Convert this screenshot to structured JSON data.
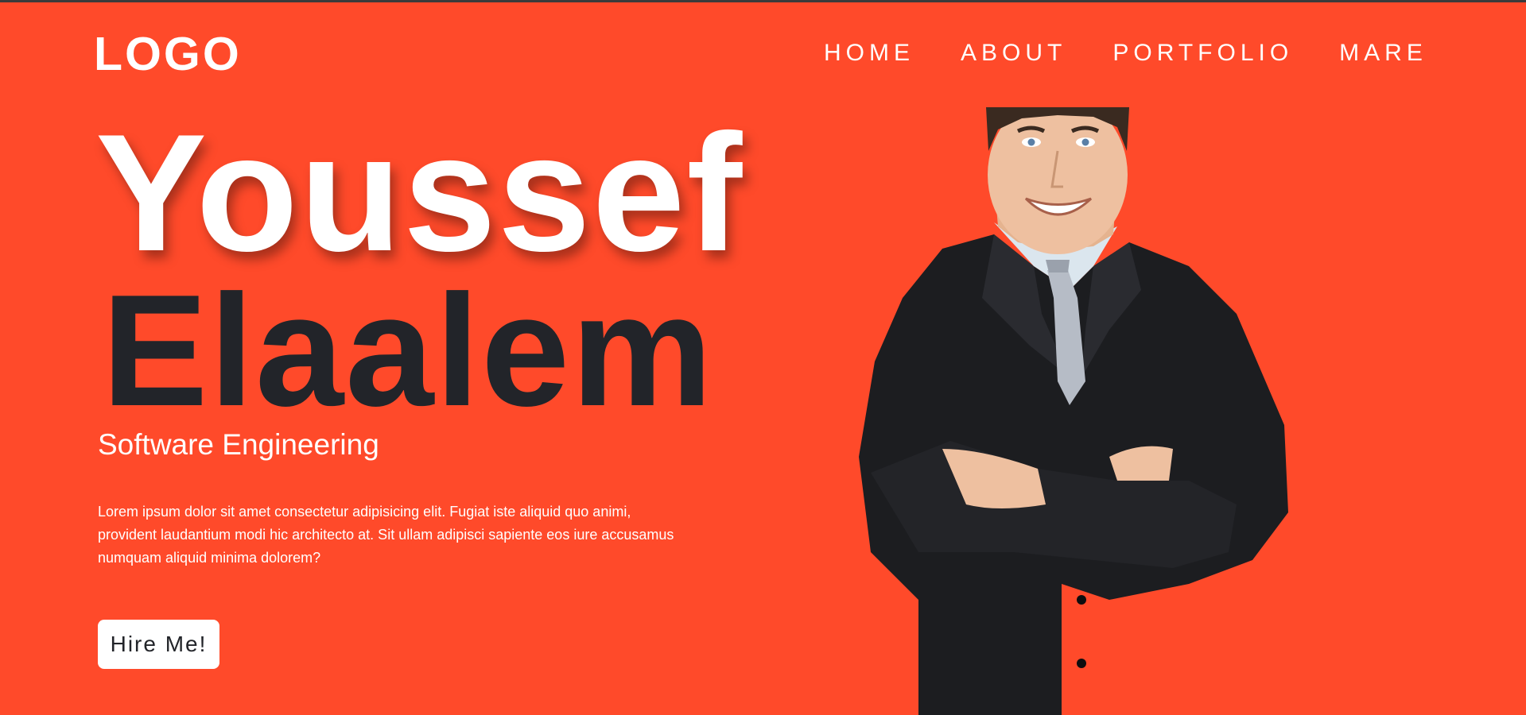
{
  "header": {
    "logo": "LOGO",
    "nav": [
      {
        "label": "HOME"
      },
      {
        "label": "ABOUT"
      },
      {
        "label": "PORTFOLIO"
      },
      {
        "label": "MARE"
      }
    ]
  },
  "hero": {
    "first_name": "Youssef",
    "last_name": "Elaalem",
    "subtitle": "Software Engineering",
    "description": "Lorem ipsum dolor sit amet consectetur adipisicing elit. Fugiat iste aliquid quo animi, provident laudantium modi hic architecto at. Sit ullam adipisci sapiente eos iure accusamus numquam aliquid minima dolorem?",
    "cta_label": "Hire Me!"
  },
  "colors": {
    "background": "#ff4a2a",
    "primary_text": "#ffffff",
    "dark_text": "#222429",
    "suit": "#1c1d20"
  },
  "portrait": {
    "icon": "businessman-photo"
  }
}
